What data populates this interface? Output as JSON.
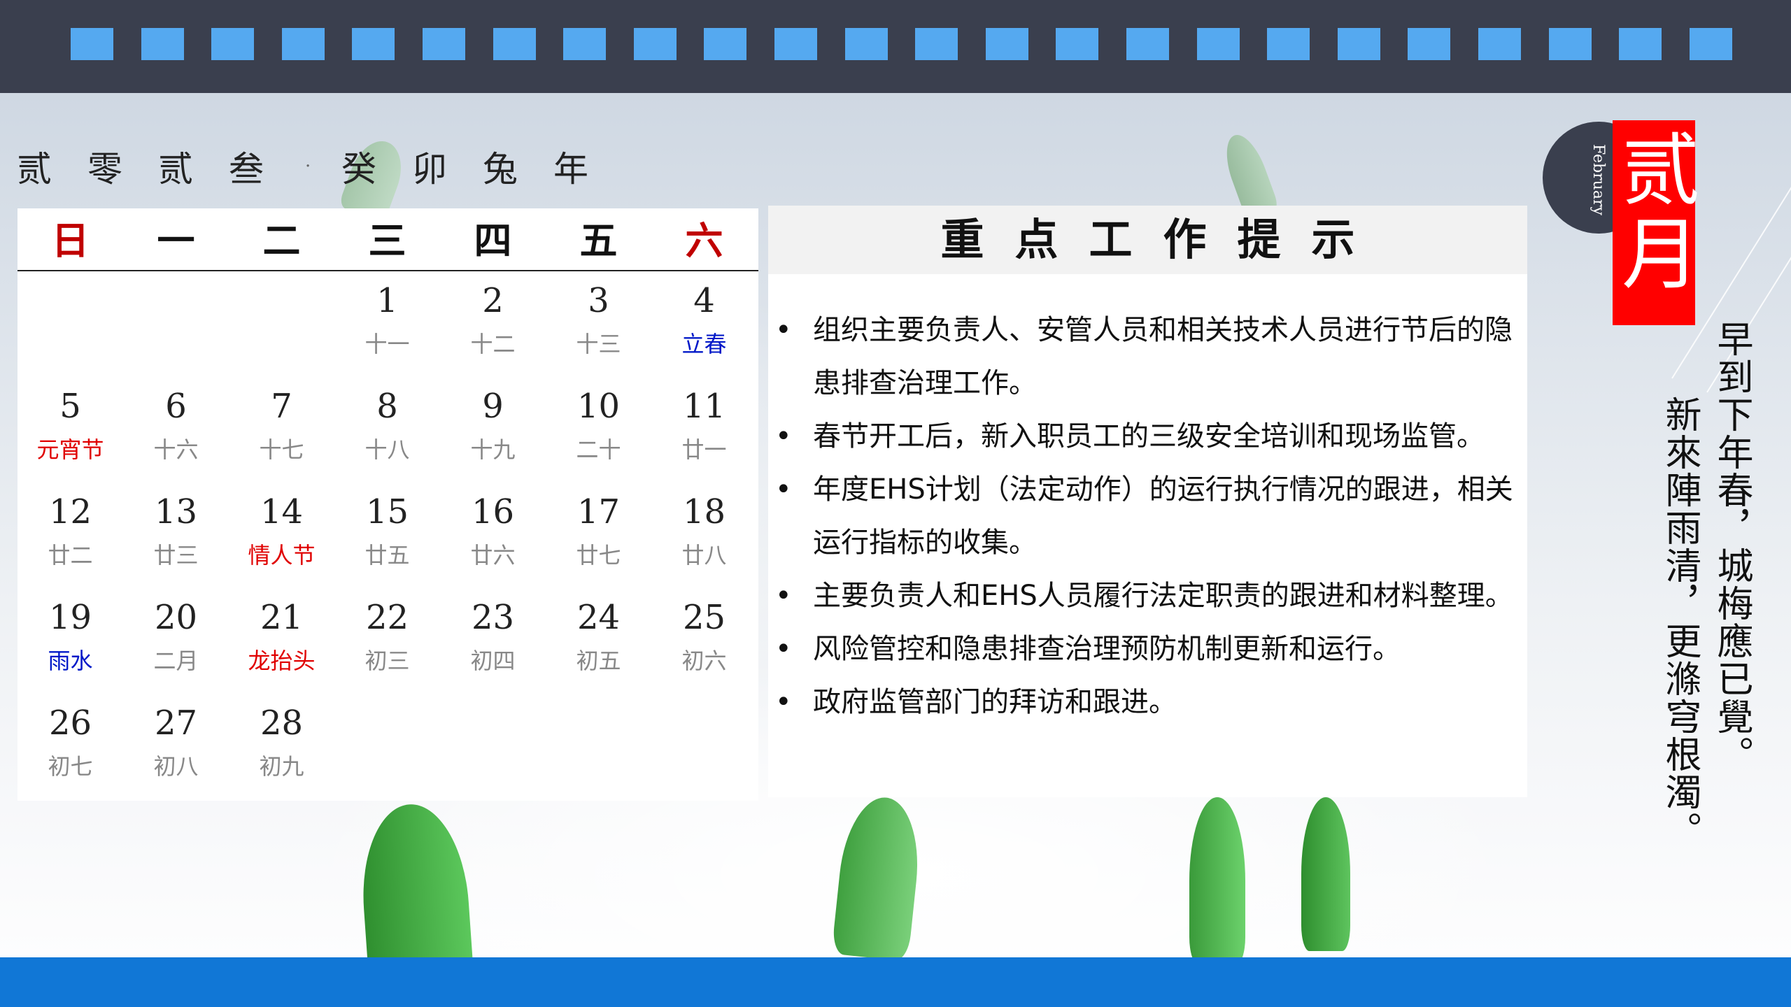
{
  "year_line": {
    "chars": [
      "贰",
      "零",
      "贰",
      "叁"
    ],
    "separator": "·",
    "ganzhi": [
      "癸",
      "卯",
      "兔",
      "年"
    ]
  },
  "calendar": {
    "weekdays": [
      "日",
      "一",
      "二",
      "三",
      "四",
      "五",
      "六"
    ],
    "days": [
      {
        "n": "1",
        "lunar": "十一",
        "kind": "normal",
        "col": 3,
        "row": 0
      },
      {
        "n": "2",
        "lunar": "十二",
        "kind": "normal",
        "col": 4,
        "row": 0
      },
      {
        "n": "3",
        "lunar": "十三",
        "kind": "normal",
        "col": 5,
        "row": 0
      },
      {
        "n": "4",
        "lunar": "立春",
        "kind": "solar-term",
        "col": 6,
        "row": 0
      },
      {
        "n": "5",
        "lunar": "元宵节",
        "kind": "festival",
        "col": 0,
        "row": 1
      },
      {
        "n": "6",
        "lunar": "十六",
        "kind": "normal",
        "col": 1,
        "row": 1
      },
      {
        "n": "7",
        "lunar": "十七",
        "kind": "normal",
        "col": 2,
        "row": 1
      },
      {
        "n": "8",
        "lunar": "十八",
        "kind": "normal",
        "col": 3,
        "row": 1
      },
      {
        "n": "9",
        "lunar": "十九",
        "kind": "normal",
        "col": 4,
        "row": 1
      },
      {
        "n": "10",
        "lunar": "二十",
        "kind": "normal",
        "col": 5,
        "row": 1
      },
      {
        "n": "11",
        "lunar": "廿一",
        "kind": "normal",
        "col": 6,
        "row": 1
      },
      {
        "n": "12",
        "lunar": "廿二",
        "kind": "normal",
        "col": 0,
        "row": 2
      },
      {
        "n": "13",
        "lunar": "廿三",
        "kind": "normal",
        "col": 1,
        "row": 2
      },
      {
        "n": "14",
        "lunar": "情人节",
        "kind": "festival",
        "col": 2,
        "row": 2
      },
      {
        "n": "15",
        "lunar": "廿五",
        "kind": "normal",
        "col": 3,
        "row": 2
      },
      {
        "n": "16",
        "lunar": "廿六",
        "kind": "normal",
        "col": 4,
        "row": 2
      },
      {
        "n": "17",
        "lunar": "廿七",
        "kind": "normal",
        "col": 5,
        "row": 2
      },
      {
        "n": "18",
        "lunar": "廿八",
        "kind": "normal",
        "col": 6,
        "row": 2
      },
      {
        "n": "19",
        "lunar": "雨水",
        "kind": "solar-term",
        "col": 0,
        "row": 3
      },
      {
        "n": "20",
        "lunar": "二月",
        "kind": "normal",
        "col": 1,
        "row": 3
      },
      {
        "n": "21",
        "lunar": "龙抬头",
        "kind": "festival",
        "col": 2,
        "row": 3
      },
      {
        "n": "22",
        "lunar": "初三",
        "kind": "normal",
        "col": 3,
        "row": 3
      },
      {
        "n": "23",
        "lunar": "初四",
        "kind": "normal",
        "col": 4,
        "row": 3
      },
      {
        "n": "24",
        "lunar": "初五",
        "kind": "normal",
        "col": 5,
        "row": 3
      },
      {
        "n": "25",
        "lunar": "初六",
        "kind": "normal",
        "col": 6,
        "row": 3
      },
      {
        "n": "26",
        "lunar": "初七",
        "kind": "normal",
        "col": 0,
        "row": 4
      },
      {
        "n": "27",
        "lunar": "初八",
        "kind": "normal",
        "col": 1,
        "row": 4
      },
      {
        "n": "28",
        "lunar": "初九",
        "kind": "normal",
        "col": 2,
        "row": 4
      }
    ]
  },
  "tips": {
    "title": "重点工作提示",
    "bullet": "•",
    "items": [
      "组织主要负责人、安管人员和相关技术人员进行节后的隐患排查治理工作。",
      "春节开工后，新入职员工的三级安全培训和现场监管。",
      "年度EHS计划（法定动作）的运行执行情况的跟进，相关运行指标的收集。",
      "主要负责人和EHS人员履行法定职责的跟进和材料整理。",
      "风险管控和隐患排查治理预防机制更新和运行。",
      "政府监管部门的拜访和跟进。"
    ]
  },
  "month": {
    "en": "February",
    "cn": "贰月"
  },
  "poem": {
    "line1": "早到下年春，城梅應已覺。",
    "line2": "新來陣雨清，更滌穹根濁。"
  },
  "colors": {
    "top_bar": "#3a3f4e",
    "film_square": "#55a9f0",
    "bottom_bar": "#1177d6",
    "festival": "#e00000",
    "solar_term": "#0018c8",
    "weekend_header": "#c00000",
    "month_box": "#ff0000"
  }
}
